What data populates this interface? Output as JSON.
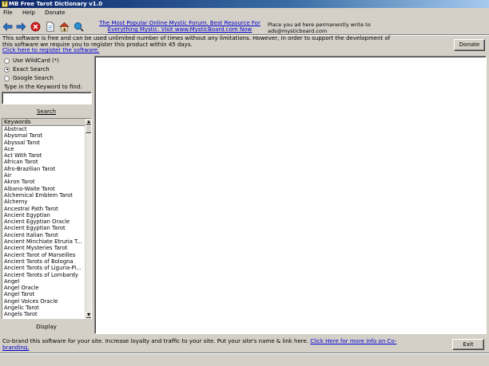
{
  "window": {
    "title": "MB Free Tarot Dictionary v1.0"
  },
  "menu": [
    "File",
    "Help",
    "Donate"
  ],
  "toolbar": {
    "icons": [
      "back-arrow-icon",
      "forward-arrow-icon",
      "stop-icon",
      "document-icon",
      "home-icon",
      "search-globe-icon"
    ]
  },
  "ad": {
    "link_text": "The Most Popular Online Mystic Forum. Best Resource For Everything Mystic. Visit www.MysticBoard.com Now",
    "placement_text": "Place you ad here permanently write to ads@mysticboard.com"
  },
  "notice": {
    "text": "This software is free and can be used unlimited number of times without any limitations. However, in order to support the development of this software we require you to register this product within 45 days.",
    "register_link": "Click here to register the software."
  },
  "donate_label": "Donate",
  "search": {
    "options": [
      {
        "label": "Use WildCard (*)",
        "selected": false
      },
      {
        "label": "Exact Search",
        "selected": true
      },
      {
        "label": "Google Search",
        "selected": false
      }
    ],
    "prompt": "Type in the Keyword to find:",
    "value": "",
    "button_label": "Search"
  },
  "keywords": {
    "header": "Keywords",
    "items": [
      "Abstract",
      "Abysmal Tarot",
      "Abyssal Tarot",
      "Ace",
      "Act With Tarot",
      "African Tarot",
      "Afro-Brazilian Tarot",
      "Air",
      "Akron Tarot",
      "Albano-Waite Tarot",
      "Alchemical Emblem Tarot",
      "Alchemy",
      "Ancestral Path Tarot",
      "Ancient Egyptian",
      "Ancient Egyptian Oracle",
      "Ancient Egyptian Tarot",
      "Ancient Italian Tarot",
      "Ancient Minchiate Etruria T...",
      "Ancient Mysteries Tarot",
      "Ancient Tarot of Marseilles",
      "Ancient Tarots of Bologna",
      "Ancient Tarots of Liguria-Pi...",
      "Ancient Tarots of Lombardy",
      "Angel",
      "Angel Oracle",
      "Angel Tarot",
      "Angel Voices Oracle",
      "Angelic Tarot",
      "Angels Tarot"
    ]
  },
  "display_label": "Display",
  "footer": {
    "text": "Co-brand this software for your site.  Increase loyalty and traffic to your site. Put your site's name &  link here.",
    "link": "Click Here for more info on Co-branding."
  },
  "exit_label": "Exit"
}
